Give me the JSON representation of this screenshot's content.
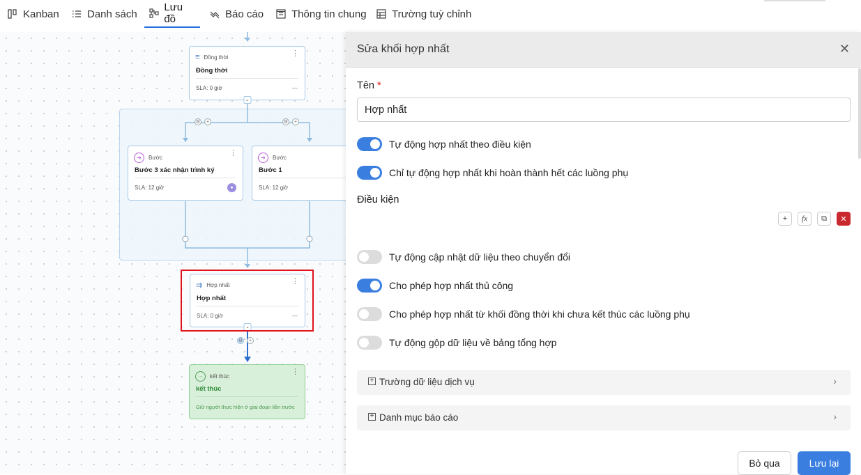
{
  "nav": {
    "tabs": [
      {
        "label": "Kanban",
        "icon": "kanban-icon"
      },
      {
        "label": "Danh sách",
        "icon": "list-icon"
      },
      {
        "label": "Lưu đồ",
        "icon": "flowchart-icon",
        "active": true
      },
      {
        "label": "Báo cáo",
        "icon": "report-icon"
      },
      {
        "label": "Thông tin chung",
        "icon": "info-icon"
      },
      {
        "label": "Trường tuỳ chỉnh",
        "icon": "custom-fields-icon"
      }
    ]
  },
  "flow": {
    "parallel": {
      "type": "Đồng thời",
      "title": "Đồng thời",
      "sla": "SLA: 0 giờ",
      "dash": "—"
    },
    "step1": {
      "type": "Bước",
      "title": "Bước 3 xác nhận trình ký",
      "sla": "SLA: 12 giờ"
    },
    "step2": {
      "type": "Bước",
      "title": "Bước 1",
      "sla": "SLA: 12 giờ"
    },
    "merge": {
      "type": "Hợp nhất",
      "title": "Hợp nhất",
      "sla": "SLA: 0 giờ",
      "dash": "—"
    },
    "end": {
      "type": "kết thúc",
      "title": "kết thúc",
      "note": "Giữ người thực hiện ở giai đoạn liền trước"
    }
  },
  "panel": {
    "title": "Sửa khối hợp nhất",
    "name_label": "Tên",
    "required_mark": "*",
    "name_value": "Hợp nhất",
    "toggles": [
      {
        "label": "Tự động hợp nhất theo điều kiện",
        "on": true
      },
      {
        "label": "Chỉ tự động hợp nhất khi hoàn thành hết các luồng phụ",
        "on": true
      }
    ],
    "condition_label": "Điều kiện",
    "toggles2": [
      {
        "label": "Tự động cập nhật dữ liệu theo chuyển đổi",
        "on": false
      },
      {
        "label": "Cho phép hợp nhất thủ công",
        "on": true
      },
      {
        "label": "Cho phép hợp nhất từ khối đồng thời khi chưa kết thúc các luồng phụ",
        "on": false
      },
      {
        "label": "Tự động gộp dữ liệu về bảng tổng hợp",
        "on": false
      }
    ],
    "sections": [
      "Trường dữ liệu dịch vụ",
      "Danh mục báo cáo"
    ],
    "cancel": "Bỏ qua",
    "save": "Lưu lại"
  }
}
